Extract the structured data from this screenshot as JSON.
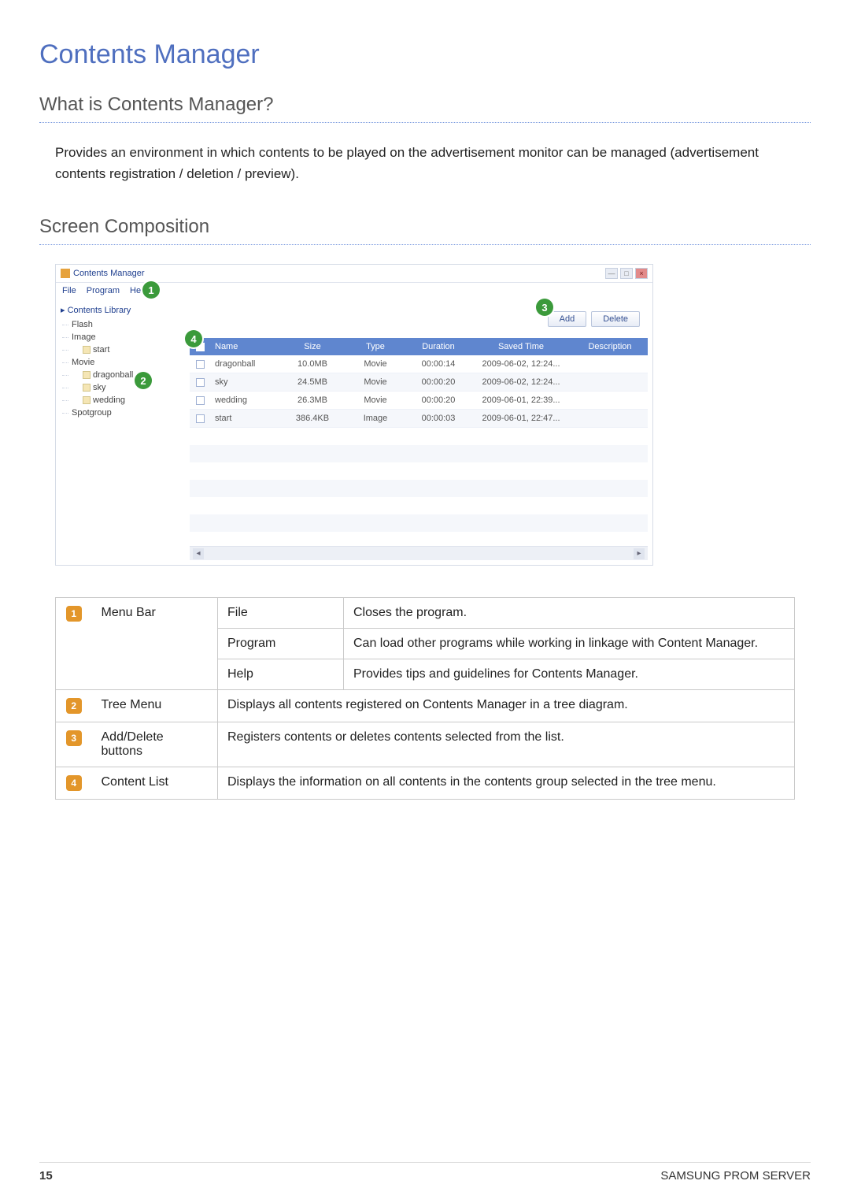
{
  "title": "Contents Manager",
  "section1": {
    "heading": "What is Contents Manager?",
    "body": "Provides an environment in which contents to be played on the advertisement monitor can be managed (advertisement contents registration / deletion / preview)."
  },
  "section2": {
    "heading": "Screen Composition"
  },
  "screenshot": {
    "app_title": "Contents Manager",
    "menus": {
      "file": "File",
      "program": "Program",
      "help": "Help"
    },
    "tree": {
      "root": "Contents Library",
      "items": [
        "Flash",
        "Image",
        "start",
        "Movie",
        "dragonball",
        "sky",
        "wedding",
        "Spotgroup"
      ]
    },
    "buttons": {
      "add": "Add",
      "delete": "Delete"
    },
    "columns": {
      "name": "Name",
      "size": "Size",
      "type": "Type",
      "duration": "Duration",
      "saved": "Saved Time",
      "desc": "Description"
    },
    "rows": [
      {
        "name": "dragonball",
        "size": "10.0MB",
        "type": "Movie",
        "duration": "00:00:14",
        "saved": "2009-06-02, 12:24...",
        "desc": ""
      },
      {
        "name": "sky",
        "size": "24.5MB",
        "type": "Movie",
        "duration": "00:00:20",
        "saved": "2009-06-02, 12:24...",
        "desc": ""
      },
      {
        "name": "wedding",
        "size": "26.3MB",
        "type": "Movie",
        "duration": "00:00:20",
        "saved": "2009-06-01, 22:39...",
        "desc": ""
      },
      {
        "name": "start",
        "size": "386.4KB",
        "type": "Image",
        "duration": "00:00:03",
        "saved": "2009-06-01, 22:47...",
        "desc": ""
      }
    ],
    "callouts": {
      "c1": "1",
      "c2": "2",
      "c3": "3",
      "c4": "4"
    }
  },
  "legend": {
    "r1": {
      "num": "1",
      "label": "Menu Bar",
      "sub": [
        {
          "k": "File",
          "v": "Closes the program."
        },
        {
          "k": "Program",
          "v": "Can load other programs while working in linkage with Content Manager."
        },
        {
          "k": "Help",
          "v": "Provides tips and guidelines for Contents Manager."
        }
      ]
    },
    "r2": {
      "num": "2",
      "label": "Tree Menu",
      "desc": "Displays all contents registered on Contents Manager in a tree diagram."
    },
    "r3": {
      "num": "3",
      "label": "Add/Delete buttons",
      "desc": "Registers contents or deletes contents selected from the list."
    },
    "r4": {
      "num": "4",
      "label": "Content List",
      "desc": "Displays the information on all contents in the contents group selected in the tree menu."
    }
  },
  "footer": {
    "page": "15",
    "brand": "SAMSUNG PROM SERVER"
  }
}
